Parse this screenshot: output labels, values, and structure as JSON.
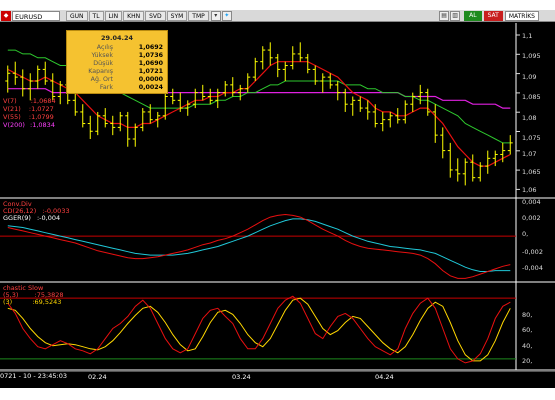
{
  "toolbar": {
    "symbol": "EURUSD",
    "buttons": [
      "GUN",
      "TL",
      "LIN",
      "KHN",
      "SVD",
      "SYM",
      "TMP"
    ],
    "buy_label": "AL",
    "sell_label": "SAT",
    "matriks_label": "MATRİKS"
  },
  "infobox": {
    "date": "29.04.24",
    "rows": [
      {
        "k": "Açılış",
        "v": "1,0692"
      },
      {
        "k": "Yüksek",
        "v": "1,0736"
      },
      {
        "k": "Düşük",
        "v": "1,0690"
      },
      {
        "k": "Kapanış",
        "v": "1,0721"
      },
      {
        "k": "Ağ. Ort",
        "v": "0,0000"
      },
      {
        "k": "Fark",
        "v": "0,0024"
      }
    ]
  },
  "main_panel": {
    "legend": [
      {
        "label": "V(7)",
        "value": ":1,0684",
        "color": "#ff3030"
      },
      {
        "label": "V(21)",
        "value": ":1,0727",
        "color": "#ff3030"
      },
      {
        "label": "V(55)",
        "value": ":1,0799",
        "color": "#ff3030"
      },
      {
        "label": "V(200)",
        "value": ":1,0834",
        "color": "#ff30ff"
      }
    ],
    "y_ticks": [
      "1,1",
      "1,095",
      "1,09",
      "1,085",
      "1,08",
      "1,075",
      "1,07",
      "1,065",
      "1,06"
    ]
  },
  "macd_panel": {
    "title": "Conv.Div",
    "legend": [
      {
        "label": "CD(26,12)",
        "value": ":-0,0033",
        "color": "#ff3030"
      },
      {
        "label": "GGER(9)",
        "value": ":-0,004",
        "color": "#ffffff"
      }
    ],
    "y_ticks": [
      "0,004",
      "0,002",
      "0,",
      "-0,002",
      "-0,004"
    ]
  },
  "stoch_panel": {
    "title": "chastic Slow",
    "legend": [
      {
        "label": "(5,3)",
        "value": ":75,3828",
        "color": "#ff3030"
      },
      {
        "label": "(3)",
        "value": ":69,5243",
        "color": "#ffffff"
      }
    ],
    "y_ticks": [
      "80,",
      "60,",
      "40,",
      "20,"
    ]
  },
  "status": {
    "text": "0721 - 10 - 23:45:03",
    "date_labels": [
      "02.24",
      "03.24",
      "04.24"
    ]
  },
  "colors": {
    "background": "#000000",
    "candle": "#ffff00",
    "ma_red": "#e81010",
    "ma_green": "#2ec82e",
    "ma_magenta": "#e020e0",
    "macd_red": "#e81010",
    "macd_signal": "#20c8d8",
    "stoch_red": "#e81010",
    "stoch_yellow": "#ffd700",
    "overbought": "#c80000",
    "oversold": "#1e8a1e"
  },
  "chart_data": {
    "type": "line",
    "title": "EURUSD",
    "ylim": [
      1.058,
      1.103
    ],
    "candles": [
      [
        1.088,
        1.092,
        1.085,
        1.09
      ],
      [
        1.09,
        1.093,
        1.087,
        1.089
      ],
      [
        1.089,
        1.091,
        1.084,
        1.086
      ],
      [
        1.086,
        1.09,
        1.083,
        1.088
      ],
      [
        1.088,
        1.092,
        1.086,
        1.091
      ],
      [
        1.091,
        1.093,
        1.087,
        1.088
      ],
      [
        1.088,
        1.09,
        1.083,
        1.084
      ],
      [
        1.084,
        1.088,
        1.082,
        1.087
      ],
      [
        1.087,
        1.089,
        1.082,
        1.083
      ],
      [
        1.083,
        1.085,
        1.079,
        1.08
      ],
      [
        1.08,
        1.082,
        1.076,
        1.077
      ],
      [
        1.077,
        1.079,
        1.073,
        1.075
      ],
      [
        1.075,
        1.08,
        1.074,
        1.079
      ],
      [
        1.079,
        1.081,
        1.076,
        1.077
      ],
      [
        1.077,
        1.079,
        1.074,
        1.076
      ],
      [
        1.076,
        1.08,
        1.075,
        1.079
      ],
      [
        1.079,
        1.08,
        1.071,
        1.073
      ],
      [
        1.073,
        1.077,
        1.071,
        1.076
      ],
      [
        1.076,
        1.081,
        1.075,
        1.08
      ],
      [
        1.08,
        1.082,
        1.077,
        1.078
      ],
      [
        1.078,
        1.08,
        1.076,
        1.079
      ],
      [
        1.079,
        1.085,
        1.078,
        1.084
      ],
      [
        1.084,
        1.086,
        1.082,
        1.083
      ],
      [
        1.083,
        1.085,
        1.08,
        1.081
      ],
      [
        1.081,
        1.083,
        1.079,
        1.082
      ],
      [
        1.082,
        1.086,
        1.081,
        1.085
      ],
      [
        1.085,
        1.087,
        1.083,
        1.084
      ],
      [
        1.084,
        1.086,
        1.082,
        1.083
      ],
      [
        1.083,
        1.086,
        1.081,
        1.085
      ],
      [
        1.085,
        1.088,
        1.084,
        1.087
      ],
      [
        1.087,
        1.089,
        1.084,
        1.085
      ],
      [
        1.085,
        1.087,
        1.083,
        1.086
      ],
      [
        1.086,
        1.09,
        1.085,
        1.089
      ],
      [
        1.089,
        1.094,
        1.088,
        1.093
      ],
      [
        1.093,
        1.097,
        1.091,
        1.096
      ],
      [
        1.096,
        1.098,
        1.092,
        1.094
      ],
      [
        1.094,
        1.095,
        1.089,
        1.091
      ],
      [
        1.091,
        1.093,
        1.088,
        1.092
      ],
      [
        1.092,
        1.097,
        1.091,
        1.095
      ],
      [
        1.095,
        1.098,
        1.093,
        1.094
      ],
      [
        1.094,
        1.095,
        1.09,
        1.091
      ],
      [
        1.091,
        1.092,
        1.087,
        1.088
      ],
      [
        1.088,
        1.09,
        1.085,
        1.089
      ],
      [
        1.089,
        1.09,
        1.086,
        1.087
      ],
      [
        1.087,
        1.088,
        1.083,
        1.085
      ],
      [
        1.085,
        1.086,
        1.08,
        1.082
      ],
      [
        1.082,
        1.084,
        1.079,
        1.083
      ],
      [
        1.083,
        1.084,
        1.08,
        1.081
      ],
      [
        1.081,
        1.083,
        1.078,
        1.08
      ],
      [
        1.08,
        1.082,
        1.076,
        1.077
      ],
      [
        1.077,
        1.08,
        1.075,
        1.078
      ],
      [
        1.078,
        1.08,
        1.076,
        1.079
      ],
      [
        1.079,
        1.081,
        1.077,
        1.078
      ],
      [
        1.078,
        1.083,
        1.077,
        1.082
      ],
      [
        1.082,
        1.085,
        1.08,
        1.084
      ],
      [
        1.084,
        1.087,
        1.082,
        1.085
      ],
      [
        1.085,
        1.086,
        1.079,
        1.08
      ],
      [
        1.08,
        1.082,
        1.072,
        1.074
      ],
      [
        1.074,
        1.076,
        1.068,
        1.07
      ],
      [
        1.07,
        1.072,
        1.063,
        1.065
      ],
      [
        1.065,
        1.068,
        1.062,
        1.064
      ],
      [
        1.064,
        1.068,
        1.061,
        1.067
      ],
      [
        1.067,
        1.069,
        1.062,
        1.063
      ],
      [
        1.063,
        1.067,
        1.062,
        1.066
      ],
      [
        1.066,
        1.07,
        1.064,
        1.068
      ],
      [
        1.068,
        1.07,
        1.066,
        1.069
      ],
      [
        1.069,
        1.072,
        1.067,
        1.07
      ],
      [
        1.07,
        1.074,
        1.069,
        1.072
      ]
    ],
    "ma_red": [
      1.091,
      1.09,
      1.089,
      1.088,
      1.088,
      1.089,
      1.088,
      1.087,
      1.086,
      1.085,
      1.083,
      1.081,
      1.079,
      1.078,
      1.077,
      1.077,
      1.076,
      1.076,
      1.077,
      1.077,
      1.078,
      1.079,
      1.08,
      1.081,
      1.082,
      1.083,
      1.083,
      1.084,
      1.084,
      1.085,
      1.085,
      1.086,
      1.086,
      1.088,
      1.09,
      1.092,
      1.093,
      1.093,
      1.093,
      1.093,
      1.093,
      1.092,
      1.091,
      1.09,
      1.089,
      1.087,
      1.085,
      1.084,
      1.083,
      1.081,
      1.08,
      1.08,
      1.079,
      1.079,
      1.08,
      1.081,
      1.081,
      1.079,
      1.077,
      1.074,
      1.071,
      1.069,
      1.067,
      1.066,
      1.066,
      1.067,
      1.068,
      1.069
    ],
    "ma_green": [
      1.096,
      1.096,
      1.095,
      1.095,
      1.094,
      1.094,
      1.093,
      1.092,
      1.092,
      1.091,
      1.09,
      1.089,
      1.088,
      1.087,
      1.086,
      1.085,
      1.084,
      1.083,
      1.082,
      1.081,
      1.081,
      1.081,
      1.081,
      1.081,
      1.081,
      1.082,
      1.082,
      1.082,
      1.083,
      1.083,
      1.084,
      1.084,
      1.085,
      1.085,
      1.086,
      1.087,
      1.087,
      1.088,
      1.088,
      1.088,
      1.088,
      1.088,
      1.088,
      1.088,
      1.088,
      1.087,
      1.087,
      1.087,
      1.086,
      1.086,
      1.085,
      1.085,
      1.085,
      1.084,
      1.084,
      1.083,
      1.083,
      1.082,
      1.081,
      1.08,
      1.079,
      1.077,
      1.076,
      1.075,
      1.074,
      1.073,
      1.072,
      1.072
    ],
    "ma_magenta": [
      1.086,
      1.086,
      1.086,
      1.086,
      1.086,
      1.086,
      1.085,
      1.085,
      1.085,
      1.085,
      1.085,
      1.085,
      1.085,
      1.085,
      1.085,
      1.085,
      1.085,
      1.085,
      1.085,
      1.085,
      1.085,
      1.085,
      1.085,
      1.085,
      1.085,
      1.085,
      1.085,
      1.085,
      1.085,
      1.085,
      1.085,
      1.085,
      1.085,
      1.085,
      1.085,
      1.085,
      1.085,
      1.085,
      1.085,
      1.085,
      1.085,
      1.085,
      1.085,
      1.085,
      1.085,
      1.085,
      1.085,
      1.085,
      1.085,
      1.085,
      1.085,
      1.085,
      1.085,
      1.084,
      1.084,
      1.084,
      1.084,
      1.084,
      1.083,
      1.083,
      1.083,
      1.083,
      1.082,
      1.082,
      1.082,
      1.082,
      1.081,
      1.081
    ],
    "macd_ylim": [
      -0.0052,
      0.0043
    ],
    "macd": [
      0.001,
      0.0008,
      0.0006,
      0.0004,
      0.0002,
      0.0,
      -0.0002,
      -0.0004,
      -0.0006,
      -0.0008,
      -0.0011,
      -0.0014,
      -0.0017,
      -0.0019,
      -0.0021,
      -0.0023,
      -0.0025,
      -0.0026,
      -0.0026,
      -0.0025,
      -0.0024,
      -0.0022,
      -0.002,
      -0.0018,
      -0.0016,
      -0.0013,
      -0.001,
      -0.0008,
      -0.0005,
      -0.0003,
      0.0,
      0.0004,
      0.0008,
      0.0013,
      0.0018,
      0.0022,
      0.0024,
      0.0025,
      0.0024,
      0.0022,
      0.0018,
      0.0013,
      0.0008,
      0.0004,
      0.0,
      -0.0005,
      -0.0009,
      -0.0012,
      -0.0014,
      -0.0015,
      -0.0016,
      -0.0017,
      -0.0018,
      -0.0019,
      -0.002,
      -0.0022,
      -0.0026,
      -0.0032,
      -0.004,
      -0.0046,
      -0.0049,
      -0.0049,
      -0.0047,
      -0.0044,
      -0.0041,
      -0.0038,
      -0.0035,
      -0.0033
    ],
    "macd_signal": [
      0.0012,
      0.0011,
      0.001,
      0.0008,
      0.0006,
      0.0004,
      0.0002,
      0.0,
      -0.0002,
      -0.0004,
      -0.0006,
      -0.0008,
      -0.001,
      -0.0012,
      -0.0014,
      -0.0016,
      -0.0018,
      -0.002,
      -0.0021,
      -0.0022,
      -0.0022,
      -0.0022,
      -0.0022,
      -0.0021,
      -0.002,
      -0.0018,
      -0.0016,
      -0.0014,
      -0.0012,
      -0.0009,
      -0.0006,
      -0.0003,
      0.0,
      0.0004,
      0.0008,
      0.0012,
      0.0015,
      0.0018,
      0.002,
      0.002,
      0.0019,
      0.0017,
      0.0014,
      0.0011,
      0.0008,
      0.0004,
      0.0,
      -0.0003,
      -0.0006,
      -0.0008,
      -0.001,
      -0.0012,
      -0.0013,
      -0.0014,
      -0.0015,
      -0.0016,
      -0.0018,
      -0.002,
      -0.0024,
      -0.0028,
      -0.0032,
      -0.0036,
      -0.0039,
      -0.0041,
      -0.0041,
      -0.004,
      -0.004,
      -0.004
    ],
    "stoch_ylim": [
      10,
      95
    ],
    "stoch_k": [
      75,
      65,
      50,
      40,
      32,
      30,
      34,
      38,
      35,
      30,
      28,
      25,
      30,
      40,
      50,
      55,
      62,
      72,
      78,
      70,
      55,
      40,
      30,
      26,
      30,
      45,
      60,
      68,
      70,
      62,
      55,
      40,
      30,
      30,
      40,
      55,
      70,
      78,
      82,
      75,
      60,
      45,
      40,
      52,
      62,
      65,
      60,
      50,
      40,
      32,
      28,
      24,
      30,
      50,
      65,
      75,
      80,
      70,
      50,
      30,
      20,
      16,
      18,
      25,
      40,
      60,
      72,
      76
    ],
    "stoch_d": [
      70,
      68,
      60,
      50,
      42,
      36,
      33,
      34,
      35,
      34,
      32,
      30,
      29,
      32,
      38,
      46,
      55,
      63,
      70,
      72,
      66,
      56,
      44,
      34,
      28,
      30,
      42,
      56,
      66,
      68,
      64,
      55,
      44,
      36,
      32,
      40,
      54,
      68,
      78,
      80,
      74,
      62,
      50,
      44,
      48,
      56,
      62,
      60,
      52,
      44,
      36,
      30,
      26,
      32,
      44,
      58,
      70,
      76,
      72,
      56,
      38,
      24,
      18,
      18,
      24,
      38,
      56,
      70
    ]
  }
}
